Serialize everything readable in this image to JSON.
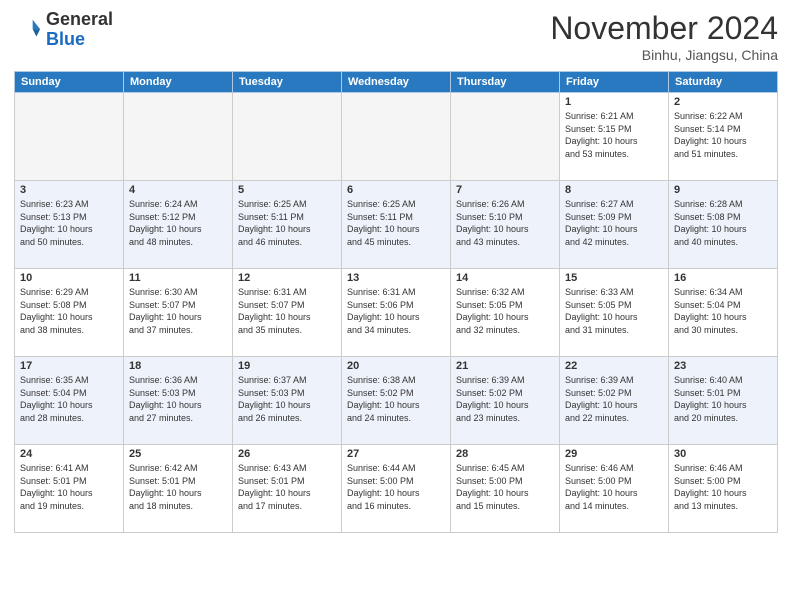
{
  "header": {
    "logo_general": "General",
    "logo_blue": "Blue",
    "month": "November 2024",
    "location": "Binhu, Jiangsu, China"
  },
  "days_of_week": [
    "Sunday",
    "Monday",
    "Tuesday",
    "Wednesday",
    "Thursday",
    "Friday",
    "Saturday"
  ],
  "weeks": [
    [
      {
        "day": "",
        "info": "",
        "empty": true
      },
      {
        "day": "",
        "info": "",
        "empty": true
      },
      {
        "day": "",
        "info": "",
        "empty": true
      },
      {
        "day": "",
        "info": "",
        "empty": true
      },
      {
        "day": "",
        "info": "",
        "empty": true
      },
      {
        "day": "1",
        "info": "Sunrise: 6:21 AM\nSunset: 5:15 PM\nDaylight: 10 hours\nand 53 minutes."
      },
      {
        "day": "2",
        "info": "Sunrise: 6:22 AM\nSunset: 5:14 PM\nDaylight: 10 hours\nand 51 minutes."
      }
    ],
    [
      {
        "day": "3",
        "info": "Sunrise: 6:23 AM\nSunset: 5:13 PM\nDaylight: 10 hours\nand 50 minutes."
      },
      {
        "day": "4",
        "info": "Sunrise: 6:24 AM\nSunset: 5:12 PM\nDaylight: 10 hours\nand 48 minutes."
      },
      {
        "day": "5",
        "info": "Sunrise: 6:25 AM\nSunset: 5:11 PM\nDaylight: 10 hours\nand 46 minutes."
      },
      {
        "day": "6",
        "info": "Sunrise: 6:25 AM\nSunset: 5:11 PM\nDaylight: 10 hours\nand 45 minutes."
      },
      {
        "day": "7",
        "info": "Sunrise: 6:26 AM\nSunset: 5:10 PM\nDaylight: 10 hours\nand 43 minutes."
      },
      {
        "day": "8",
        "info": "Sunrise: 6:27 AM\nSunset: 5:09 PM\nDaylight: 10 hours\nand 42 minutes."
      },
      {
        "day": "9",
        "info": "Sunrise: 6:28 AM\nSunset: 5:08 PM\nDaylight: 10 hours\nand 40 minutes."
      }
    ],
    [
      {
        "day": "10",
        "info": "Sunrise: 6:29 AM\nSunset: 5:08 PM\nDaylight: 10 hours\nand 38 minutes."
      },
      {
        "day": "11",
        "info": "Sunrise: 6:30 AM\nSunset: 5:07 PM\nDaylight: 10 hours\nand 37 minutes."
      },
      {
        "day": "12",
        "info": "Sunrise: 6:31 AM\nSunset: 5:07 PM\nDaylight: 10 hours\nand 35 minutes."
      },
      {
        "day": "13",
        "info": "Sunrise: 6:31 AM\nSunset: 5:06 PM\nDaylight: 10 hours\nand 34 minutes."
      },
      {
        "day": "14",
        "info": "Sunrise: 6:32 AM\nSunset: 5:05 PM\nDaylight: 10 hours\nand 32 minutes."
      },
      {
        "day": "15",
        "info": "Sunrise: 6:33 AM\nSunset: 5:05 PM\nDaylight: 10 hours\nand 31 minutes."
      },
      {
        "day": "16",
        "info": "Sunrise: 6:34 AM\nSunset: 5:04 PM\nDaylight: 10 hours\nand 30 minutes."
      }
    ],
    [
      {
        "day": "17",
        "info": "Sunrise: 6:35 AM\nSunset: 5:04 PM\nDaylight: 10 hours\nand 28 minutes."
      },
      {
        "day": "18",
        "info": "Sunrise: 6:36 AM\nSunset: 5:03 PM\nDaylight: 10 hours\nand 27 minutes."
      },
      {
        "day": "19",
        "info": "Sunrise: 6:37 AM\nSunset: 5:03 PM\nDaylight: 10 hours\nand 26 minutes."
      },
      {
        "day": "20",
        "info": "Sunrise: 6:38 AM\nSunset: 5:02 PM\nDaylight: 10 hours\nand 24 minutes."
      },
      {
        "day": "21",
        "info": "Sunrise: 6:39 AM\nSunset: 5:02 PM\nDaylight: 10 hours\nand 23 minutes."
      },
      {
        "day": "22",
        "info": "Sunrise: 6:39 AM\nSunset: 5:02 PM\nDaylight: 10 hours\nand 22 minutes."
      },
      {
        "day": "23",
        "info": "Sunrise: 6:40 AM\nSunset: 5:01 PM\nDaylight: 10 hours\nand 20 minutes."
      }
    ],
    [
      {
        "day": "24",
        "info": "Sunrise: 6:41 AM\nSunset: 5:01 PM\nDaylight: 10 hours\nand 19 minutes."
      },
      {
        "day": "25",
        "info": "Sunrise: 6:42 AM\nSunset: 5:01 PM\nDaylight: 10 hours\nand 18 minutes."
      },
      {
        "day": "26",
        "info": "Sunrise: 6:43 AM\nSunset: 5:01 PM\nDaylight: 10 hours\nand 17 minutes."
      },
      {
        "day": "27",
        "info": "Sunrise: 6:44 AM\nSunset: 5:00 PM\nDaylight: 10 hours\nand 16 minutes."
      },
      {
        "day": "28",
        "info": "Sunrise: 6:45 AM\nSunset: 5:00 PM\nDaylight: 10 hours\nand 15 minutes."
      },
      {
        "day": "29",
        "info": "Sunrise: 6:46 AM\nSunset: 5:00 PM\nDaylight: 10 hours\nand 14 minutes."
      },
      {
        "day": "30",
        "info": "Sunrise: 6:46 AM\nSunset: 5:00 PM\nDaylight: 10 hours\nand 13 minutes."
      }
    ]
  ]
}
